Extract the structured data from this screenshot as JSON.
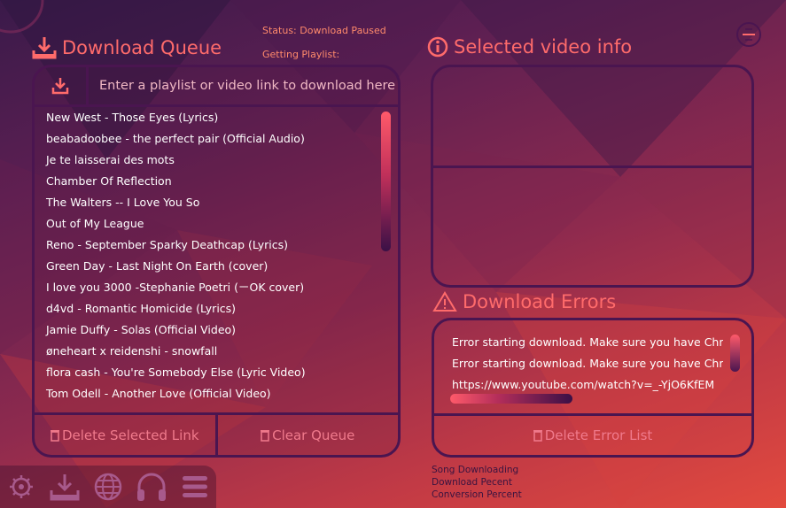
{
  "window": {
    "close_icon": "minimize-close-icon"
  },
  "status": {
    "download_status": "Status: Download Paused",
    "playlist_status": "Getting Playlist:"
  },
  "queue": {
    "title": "Download Queue",
    "title_icon": "download-tray-icon",
    "input_placeholder": "Enter a playlist or video link to download here!",
    "items": [
      {
        "artist": "New West",
        "sep": " - ",
        "song": "Those Eyes (Lyrics)"
      },
      {
        "artist": "beabadoobee",
        "sep": " - ",
        "song": "the perfect pair (Official Audio)"
      },
      {
        "artist": "",
        "sep": "",
        "song": "Je te laisserai des mots"
      },
      {
        "artist": "",
        "sep": "",
        "song": "Chamber Of Reflection"
      },
      {
        "artist": "The Walters",
        "sep": " -- ",
        "song": "I Love You So"
      },
      {
        "artist": "",
        "sep": "",
        "song": "Out of My League"
      },
      {
        "artist": "Reno",
        "sep": " - ",
        "song": "September Sparky Deathcap (Lyrics)"
      },
      {
        "artist": "Green Day",
        "sep": " - ",
        "song": "Last Night On Earth (cover)"
      },
      {
        "artist": "",
        "sep": "",
        "song": "I love you 3000 -Stephanie Poetri (ㄧOK cover)"
      },
      {
        "artist": "d4vd",
        "sep": " - ",
        "song": "Romantic Homicide (Lyrics)"
      },
      {
        "artist": "Jamie Duffy",
        "sep": " - ",
        "song": "Solas (Official Video)"
      },
      {
        "artist": "øneheart x reidenshi",
        "sep": " - ",
        "song": "snowfall"
      },
      {
        "artist": "flora cash",
        "sep": " - ",
        "song": "You're Somebody Else (Lyric Video)"
      },
      {
        "artist": "Tom Odell",
        "sep": " - ",
        "song": "Another Love (Official Video)"
      }
    ],
    "delete_selected_label": "Delete Selected Link",
    "clear_queue_label": "Clear Queue"
  },
  "video_info": {
    "title": "Selected video info",
    "title_icon": "info-circle-icon"
  },
  "errors": {
    "title": "Download Errors",
    "title_icon": "warning-triangle-icon",
    "items": [
      "Error starting download. Make sure you have Chr",
      "Error starting download. Make sure you have Chr",
      "https://www.youtube.com/watch?v=_-YjO6KfEM"
    ],
    "delete_label": "Delete Error List"
  },
  "progress": {
    "song_downloading": "Song Downloading",
    "download_percent": "Download Pecent",
    "conversion_percent": "Conversion Percent"
  },
  "nav": {
    "items": [
      "settings-gear-icon",
      "download-icon",
      "globe-icon",
      "headphones-icon",
      "menu-icon"
    ]
  },
  "colors": {
    "accent": "#ff6b6b",
    "panel_border": "#4a1550",
    "button_text": "#f07a8c"
  }
}
